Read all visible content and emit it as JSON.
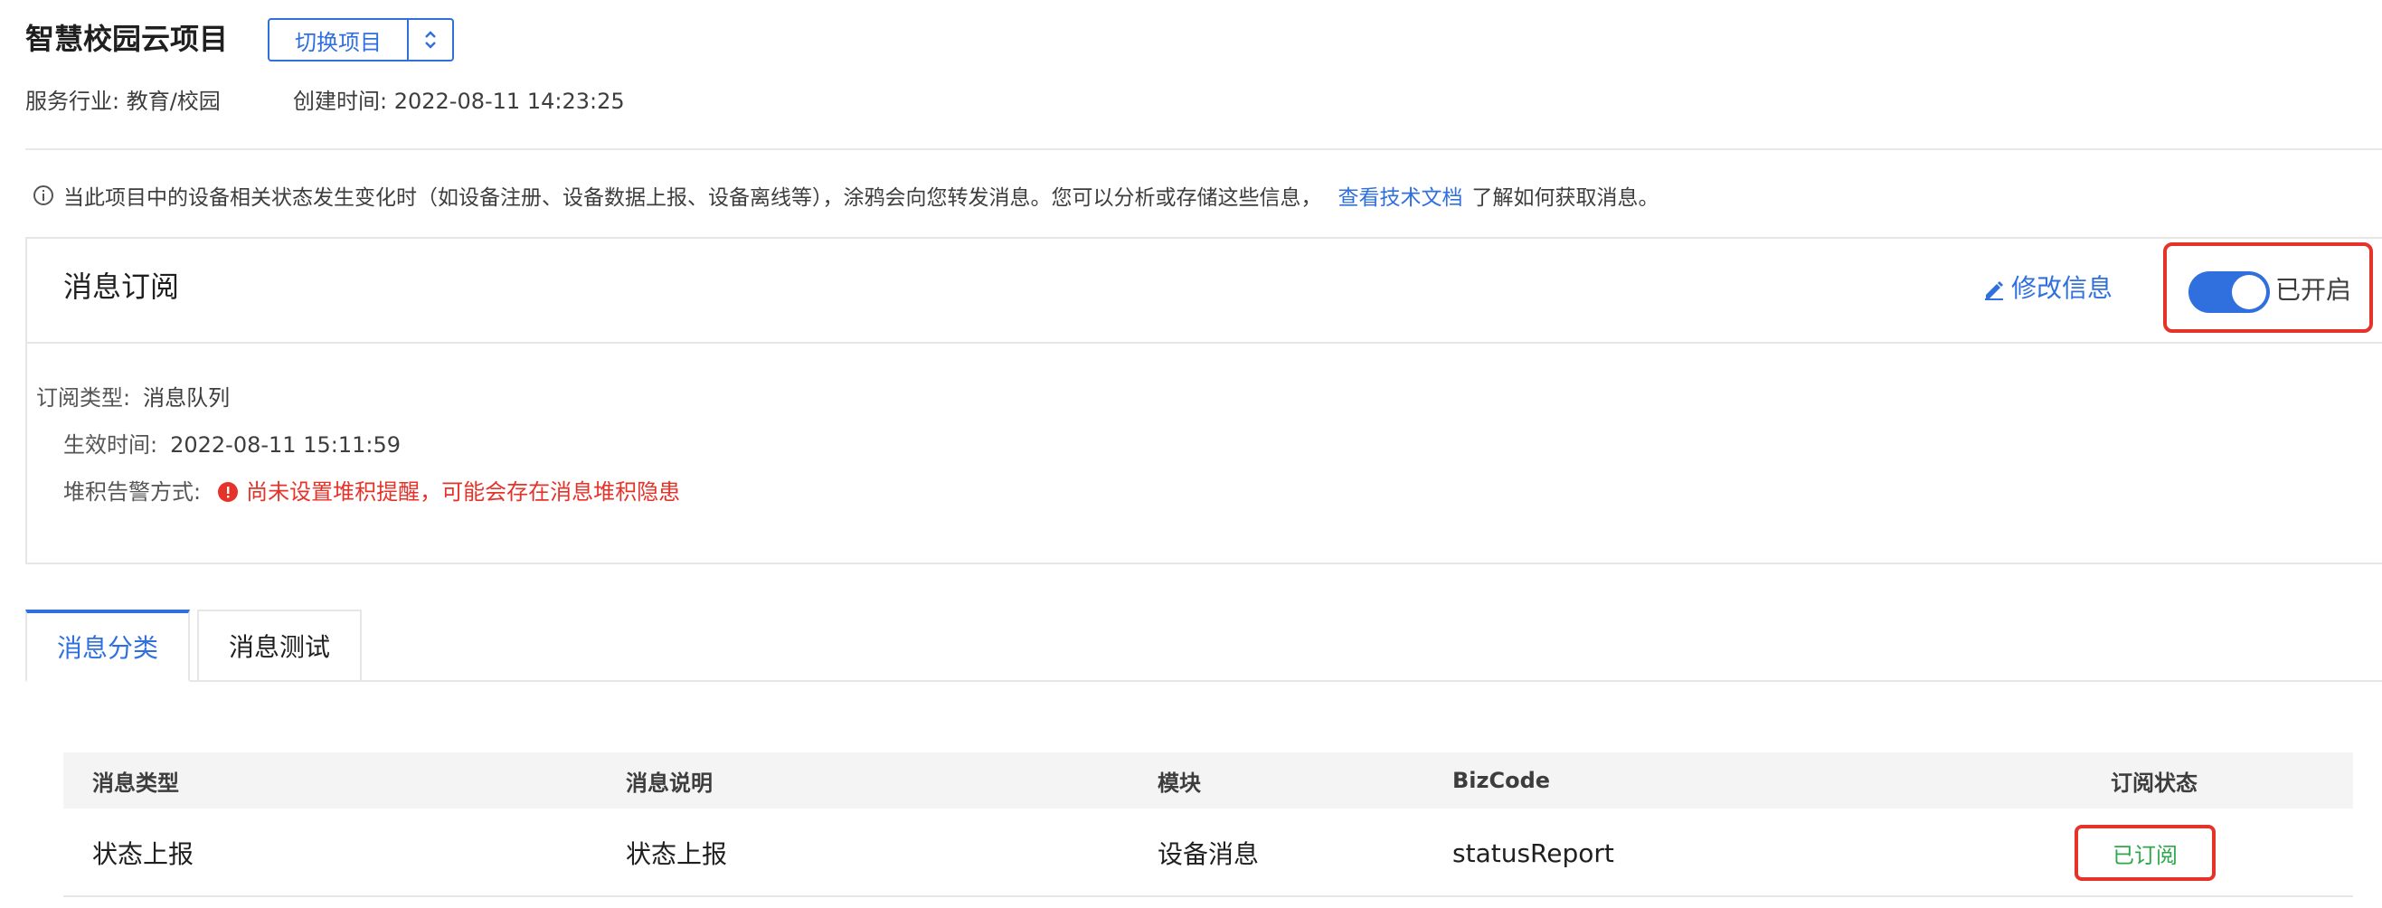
{
  "header": {
    "project_name": "智慧校园云项目",
    "switch_label": "切换项目",
    "industry": "服务行业: 教育/校园",
    "created": "创建时间: 2022-08-11 14:23:25"
  },
  "notice": {
    "text_before": "当此项目中的设备相关状态发生变化时（如设备注册、设备数据上报、设备离线等），涂鸦会向您转发消息。您可以分析或存储这些信息，",
    "link_text": "查看技术文档",
    "text_after": "了解如何获取消息。"
  },
  "subscription": {
    "title": "消息订阅",
    "edit_label": "修改信息",
    "toggle_state": "已开启",
    "toggle_on": true,
    "type_label": "订阅类型:",
    "type_value": "消息队列",
    "effective_label": "生效时间:",
    "effective_value": "2022-08-11 15:11:59",
    "alert_label": "堆积告警方式:",
    "alert_value": "尚未设置堆积提醒，可能会存在消息堆积隐患"
  },
  "tabs": [
    {
      "label": "消息分类",
      "active": true
    },
    {
      "label": "消息测试",
      "active": false
    }
  ],
  "table": {
    "columns": [
      "消息类型",
      "消息说明",
      "模块",
      "BizCode",
      "订阅状态"
    ],
    "rows": [
      {
        "type": "状态上报",
        "desc": "状态上报",
        "module": "设备消息",
        "bizcode": "statusReport",
        "status": "已订阅"
      }
    ]
  },
  "colors": {
    "accent": "#2f6fde",
    "warning": "#e5332a",
    "success": "#2ea84b"
  },
  "icons": {
    "chevron": "chevron-up-down-icon",
    "info": "info-icon",
    "edit": "edit-icon",
    "alert": "alert-icon"
  }
}
